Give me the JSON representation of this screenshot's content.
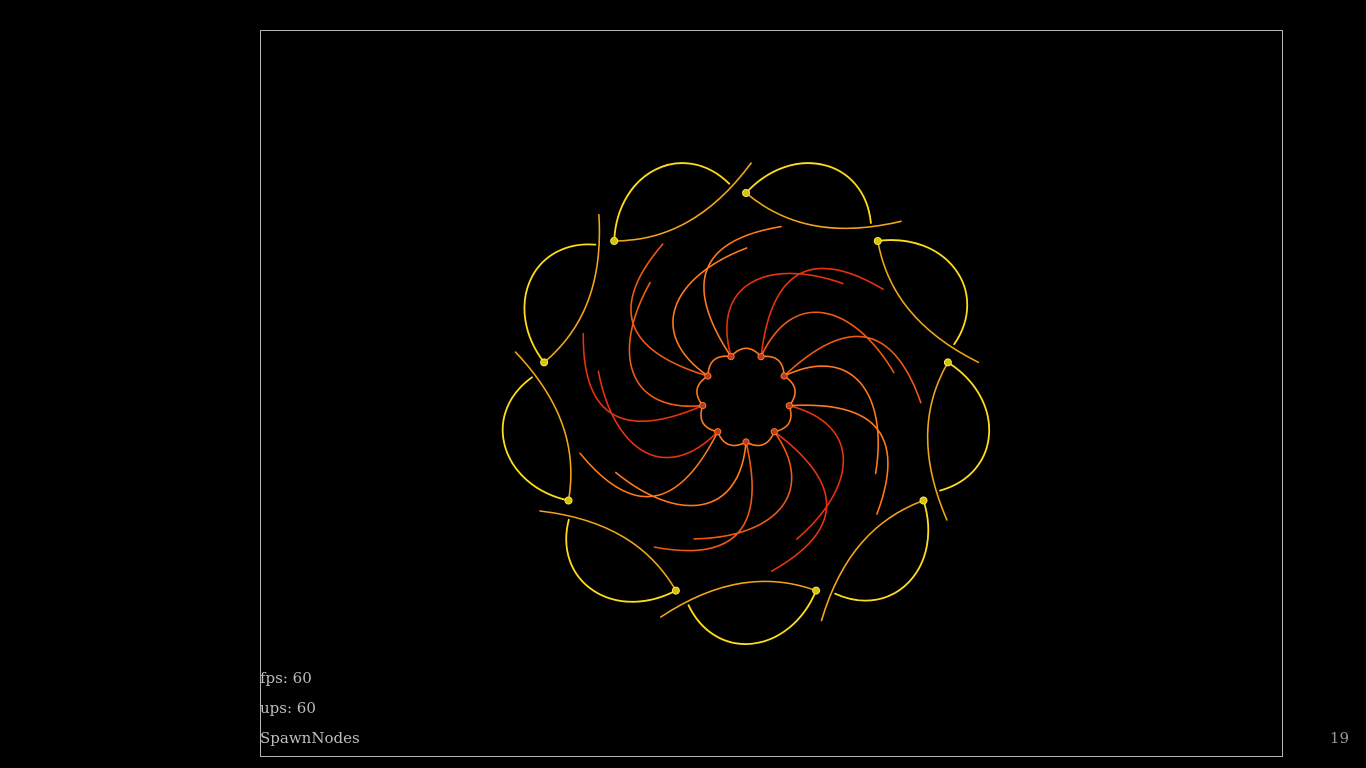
{
  "hud": {
    "fps_label": "fps: 60",
    "ups_label": "ups: 60",
    "mode_label": "SpawnNodes"
  },
  "corner_counter": "19",
  "scene": {
    "background_color": "#000000",
    "frame_color": "#b4b4b4",
    "inner_ring": {
      "node_count": 9,
      "stroke_colors": [
        "#e8320f",
        "#f05a14",
        "#ff7a1a"
      ],
      "node_color": "#c0391b"
    },
    "outer_ring": {
      "node_count": 9,
      "stroke_colors": [
        "#ffdd1a",
        "#f2a51a"
      ],
      "node_color": "#d4c400"
    }
  }
}
